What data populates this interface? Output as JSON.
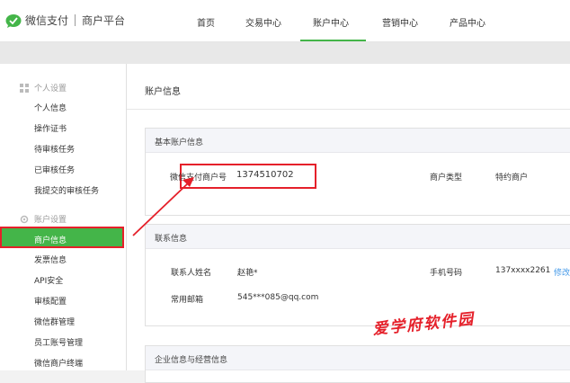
{
  "header": {
    "logo_text": "微信支付",
    "logo_sub": "商户平台",
    "nav": [
      "首页",
      "交易中心",
      "账户中心",
      "营销中心",
      "产品中心"
    ],
    "active_nav": "账户中心"
  },
  "sidebar": {
    "group1": {
      "title": "个人设置",
      "items": [
        "个人信息",
        "操作证书",
        "待审核任务",
        "已审核任务",
        "我提交的审核任务"
      ]
    },
    "group2": {
      "title": "账户设置",
      "items": [
        "商户信息",
        "发票信息",
        "API安全",
        "审核配置",
        "微信群管理",
        "员工账号管理",
        "微信商户终端"
      ]
    },
    "active_item": "商户信息"
  },
  "main": {
    "page_title": "账户信息",
    "basic": {
      "title": "基本账户信息",
      "merchant_id_label": "微信支付商户号",
      "merchant_id": "1374510702",
      "merchant_type_label": "商户类型",
      "merchant_type": "特约商户"
    },
    "contact": {
      "title": "联系信息",
      "name_label": "联系人姓名",
      "name": "赵艳*",
      "phone_label": "手机号码",
      "phone": "137xxxx2261",
      "edit_link": "修改",
      "email_label": "常用邮箱",
      "email": "545***085@qq.com"
    },
    "enterprise": {
      "title": "企业信息与经营信息"
    }
  },
  "watermark": "爱学府软件园",
  "colors": {
    "brand_green": "#44b549",
    "highlight_red": "#e5202a",
    "link_blue": "#459ae9"
  }
}
